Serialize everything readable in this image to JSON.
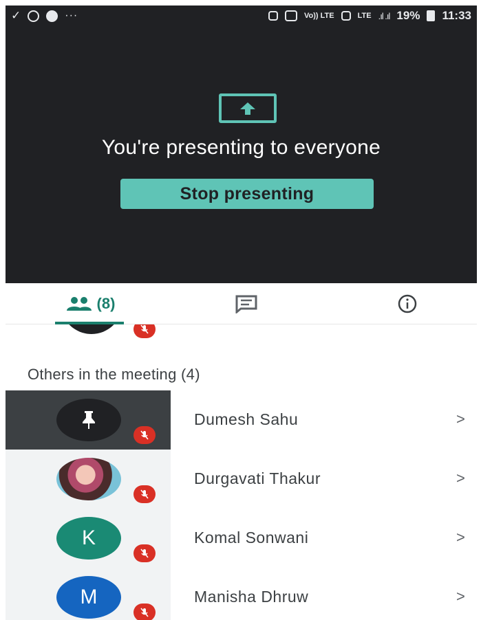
{
  "status_bar": {
    "battery_percent": "19%",
    "time": "11:33",
    "network_label_1": "Vo)) LTE",
    "network_label_2": "LTE"
  },
  "presenting": {
    "title": "You're presenting to everyone",
    "stop_button_label": "Stop presenting",
    "icon": "present-screen-icon",
    "accent_color": "#5fc4b6",
    "background_color": "#202124"
  },
  "tabs": {
    "people_count": "(8)",
    "people_icon": "people-icon",
    "chat_icon": "chat-icon",
    "info_icon": "info-icon",
    "active_color": "#1a7f6d"
  },
  "participants": {
    "section_title": "Others in the meeting (4)",
    "items": [
      {
        "name": "Dumesh Sahu",
        "avatar_type": "pin-icon",
        "avatar_color": "#202124",
        "muted": true,
        "pinned": true
      },
      {
        "name": "Durgavati Thakur",
        "avatar_type": "photo",
        "muted": true,
        "pinned": false
      },
      {
        "name": "Komal Sonwani",
        "avatar_letter": "K",
        "avatar_color": "#1a8a74",
        "muted": true,
        "pinned": false
      },
      {
        "name": "Manisha Dhruw",
        "avatar_letter": "M",
        "avatar_color": "#1565c0",
        "muted": true,
        "pinned": false
      }
    ],
    "chevron": ">"
  }
}
